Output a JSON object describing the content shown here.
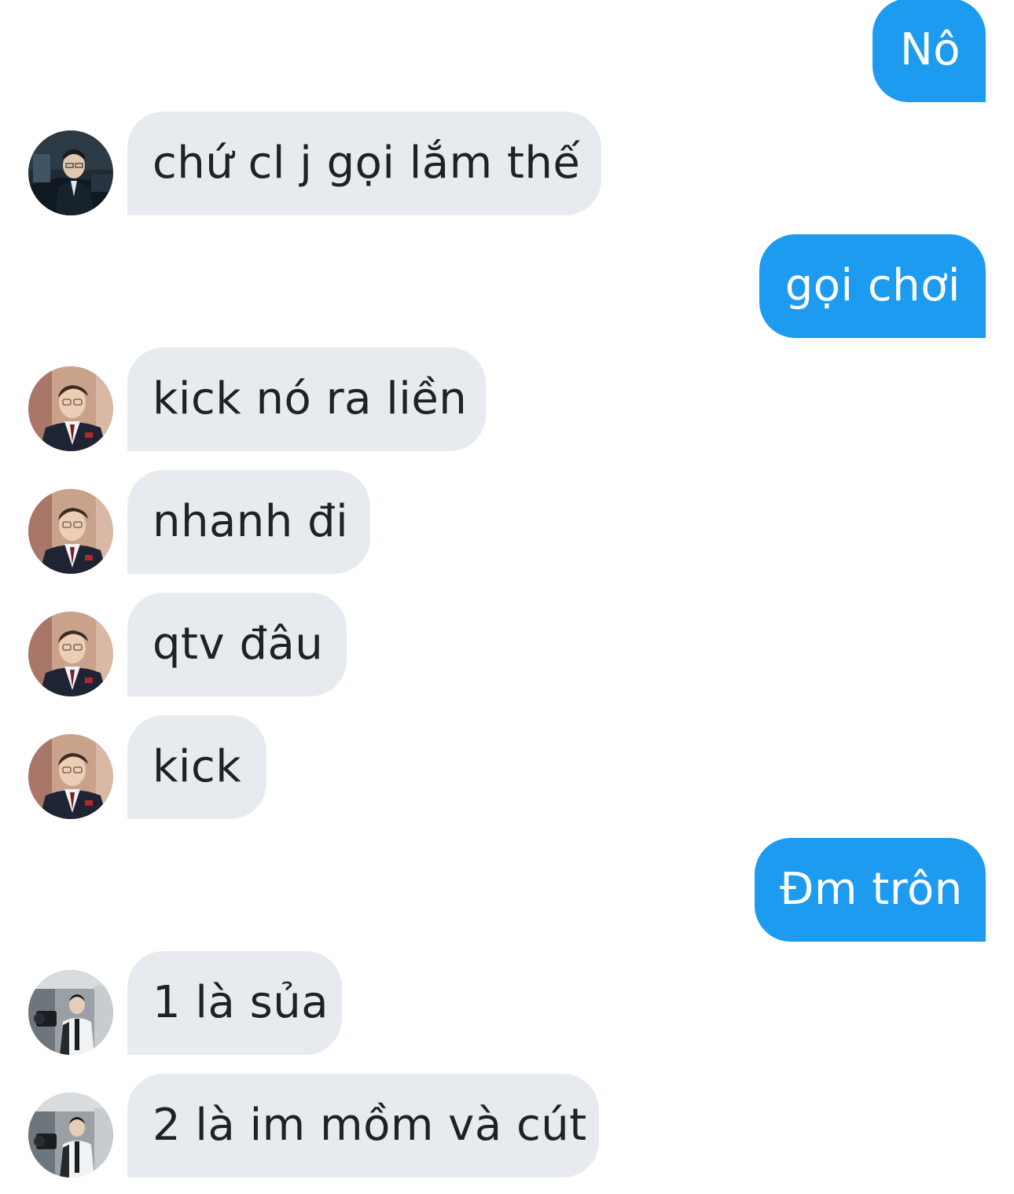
{
  "colors": {
    "outgoing_bubble": "#1d9bf0",
    "incoming_bubble": "#e7ebef",
    "outgoing_text": "#ffffff",
    "incoming_text": "#1e2226"
  },
  "messages": [
    {
      "side": "outgoing",
      "text": "Nô"
    },
    {
      "side": "incoming",
      "text": "chứ cl j gọi lắm thế",
      "avatar": "user-avatar-dark-chair"
    },
    {
      "side": "outgoing",
      "text": "gọi chơi"
    },
    {
      "side": "incoming",
      "text": "kick nó ra liền",
      "avatar": "user-avatar-uniform"
    },
    {
      "side": "incoming",
      "text": "nhanh đi",
      "avatar": "user-avatar-uniform"
    },
    {
      "side": "incoming",
      "text": "qtv đâu",
      "avatar": "user-avatar-uniform"
    },
    {
      "side": "incoming",
      "text": "kick",
      "avatar": "user-avatar-uniform"
    },
    {
      "side": "outgoing",
      "text": "Đm trôn"
    },
    {
      "side": "incoming",
      "text": "1 là sủa",
      "avatar": "user-avatar-camera"
    },
    {
      "side": "incoming",
      "text": "2 là im mồm và cút",
      "avatar": "user-avatar-camera"
    }
  ]
}
